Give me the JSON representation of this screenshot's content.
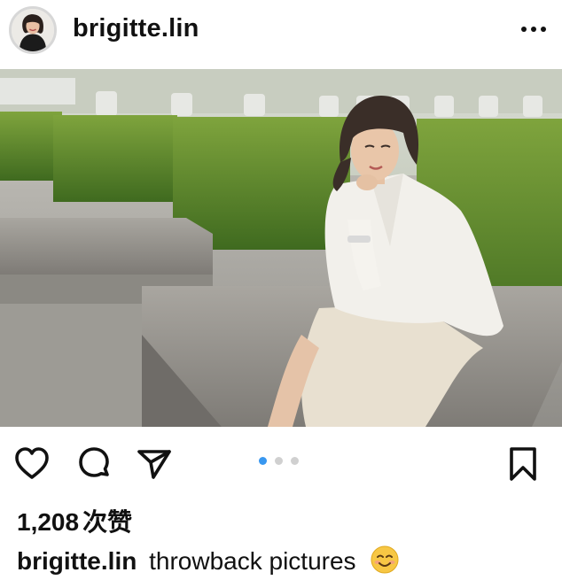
{
  "post": {
    "username": "brigitte.lin",
    "more_icon": "more-horizontal-icon",
    "image_alt": "woman in white outfit sitting on stone bench near hedges"
  },
  "actions": {
    "like_icon": "heart-icon",
    "comment_icon": "comment-icon",
    "share_icon": "send-icon",
    "save_icon": "bookmark-icon",
    "carousel_active_index": 0,
    "carousel_count": 3
  },
  "likes": {
    "count": "1,208",
    "suffix": "次赞"
  },
  "caption": {
    "username": "brigitte.lin",
    "text": "throwback pictures",
    "emoji_icon": "smiling-face-emoji"
  },
  "colors": {
    "accent_dot": "#3897f0",
    "inactive_dot": "#d0d0d0",
    "text": "#111111"
  }
}
